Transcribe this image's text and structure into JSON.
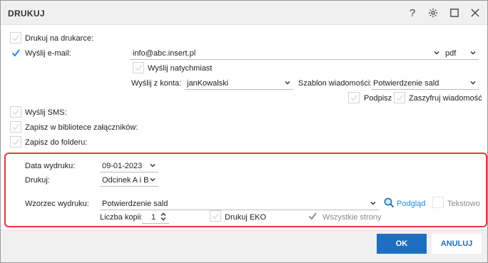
{
  "title": "DRUKUJ",
  "titlebar": {
    "help_icon": "question-icon",
    "settings_icon": "gear-icon",
    "max_icon": "maximize-icon",
    "close_icon": "close-icon"
  },
  "print_on_printer": {
    "label": "Drukuj na drukarce:",
    "checked": false
  },
  "send_email": {
    "label": "Wyślij e-mail:",
    "checked": true,
    "email": "info@abc.insert.pl",
    "format": "pdf"
  },
  "send_now": {
    "label": "Wyślij natychmiast",
    "checked": false
  },
  "send_from": {
    "label": "Wyślij z konta:",
    "value": "janKowalski"
  },
  "template": {
    "label": "Szablon wiadomości:",
    "value": "Potwierdzenie sald"
  },
  "sign": {
    "label": "Podpisz",
    "checked": false
  },
  "encrypt": {
    "label": "Zaszyfruj wiadomość",
    "checked": false
  },
  "send_sms": {
    "label": "Wyślij SMS:",
    "checked": false
  },
  "save_library": {
    "label": "Zapisz w bibliotece załączników:",
    "checked": false
  },
  "save_folder": {
    "label": "Zapisz do folderu:",
    "checked": false
  },
  "print_date": {
    "label": "Data wydruku:",
    "value": "09-01-2023"
  },
  "print_what": {
    "label": "Drukuj:",
    "value": "Odcinek A i B"
  },
  "print_pattern": {
    "label": "Wzorzec wydruku:",
    "value": "Potwierdzenie sald",
    "preview": "Podgląd",
    "text_label": "Tekstowo",
    "text_checked": false
  },
  "copies": {
    "label": "Liczba kopii:",
    "value": "1"
  },
  "eco": {
    "label": "Drukuj EKO",
    "checked": false
  },
  "all_pages": {
    "label": "Wszystkie strony",
    "checked": true
  },
  "buttons": {
    "ok": "OK",
    "cancel": "ANULUJ"
  },
  "colors": {
    "accent": "#1f6fc0",
    "highlight": "#e23a3a"
  }
}
